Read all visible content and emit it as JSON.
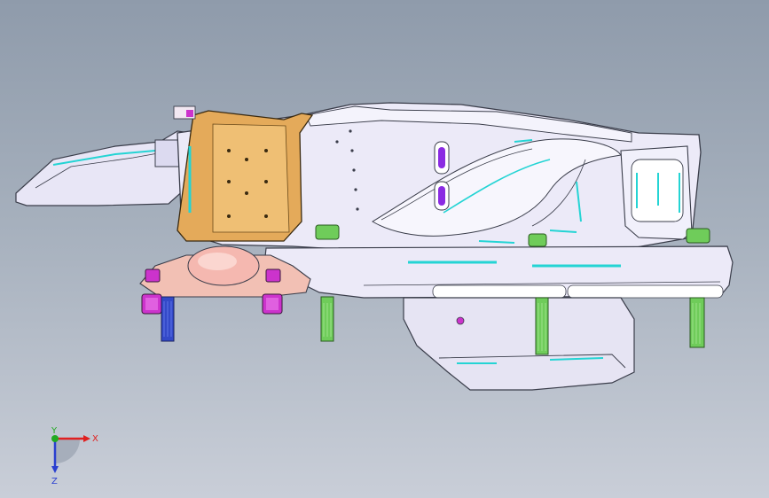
{
  "viewport": {
    "background_top": "#8f9bab",
    "background_bottom": "#c9ced8"
  },
  "model": {
    "body_color": "#e8e6f6",
    "edge_color": "#3a3d4a",
    "bracket_color": "#e4aa5a",
    "mount_color": "#f2c0b4",
    "bolt_green": "#6fcc5a",
    "bolt_magenta": "#cc33cc",
    "bolt_blue": "#3349c8",
    "accent_cyan": "#24d4d4",
    "slot_purple": "#8a2be2"
  },
  "triad": {
    "x_label": "X",
    "y_label": "Y",
    "z_label": "Z",
    "x_color": "#e02020",
    "y_color": "#22aa22",
    "z_color": "#2a3fd0"
  }
}
